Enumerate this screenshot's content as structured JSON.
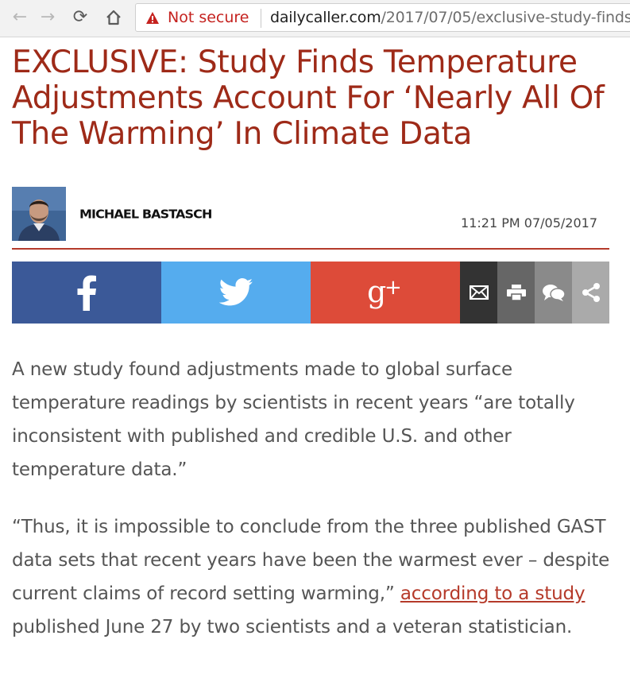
{
  "browser": {
    "security_label": "Not secure",
    "url_host": "dailycaller.com",
    "url_path": "/2017/07/05/exclusive-study-finds"
  },
  "article": {
    "title": "EXCLUSIVE: Study Finds Temperature Adjustments Account For ‘Nearly All Of The Warming’ In Climate Data",
    "author": "MICHAEL BASTASCH",
    "timestamp": "11:21 PM 07/05/2017",
    "paragraph1": "A new study found adjustments made to global surface temperature readings by scientists in recent years “are totally inconsistent with published and credible U.S. and other temperature data.”",
    "paragraph2_before_link": "“Thus, it is impossible to conclude from the three published GAST data sets that recent years have been the warmest ever – despite current claims of record setting warming,” ",
    "paragraph2_link": "according to a study",
    "paragraph2_after_link": " published June 27 by two scientists and a veteran statistician."
  },
  "share": {
    "colors": {
      "facebook": "#3b5998",
      "twitter": "#55acee",
      "google_plus": "#dd4b39",
      "email": "#333333",
      "print": "#666666",
      "comments": "#8a8a8a",
      "share": "#aaaaaa"
    },
    "icons": [
      "facebook-icon",
      "twitter-icon",
      "google-plus-icon",
      "email-icon",
      "print-icon",
      "comments-icon",
      "share-icon"
    ]
  },
  "theme": {
    "title_color": "#9e2a18",
    "accent": "#b53a2a",
    "body_text": "#555555"
  }
}
